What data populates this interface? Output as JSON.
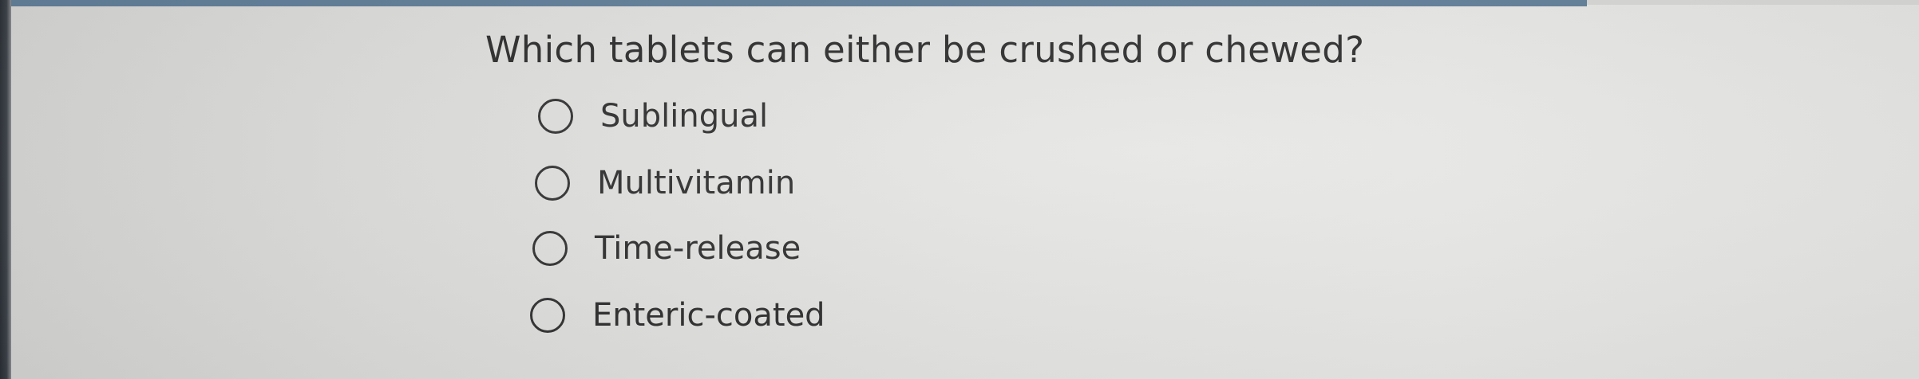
{
  "quiz": {
    "question": "Which tablets can either be crushed or chewed?",
    "options": [
      {
        "label": "Sublingual",
        "selected": false
      },
      {
        "label": "Multivitamin",
        "selected": false
      },
      {
        "label": "Time-release",
        "selected": false
      },
      {
        "label": "Enteric-coated",
        "selected": false
      }
    ]
  },
  "colors": {
    "text": "#2b2b2b",
    "background": "#e2e2e0",
    "top_bar": "#5f7d98",
    "radio_border": "#2f2f2f"
  }
}
